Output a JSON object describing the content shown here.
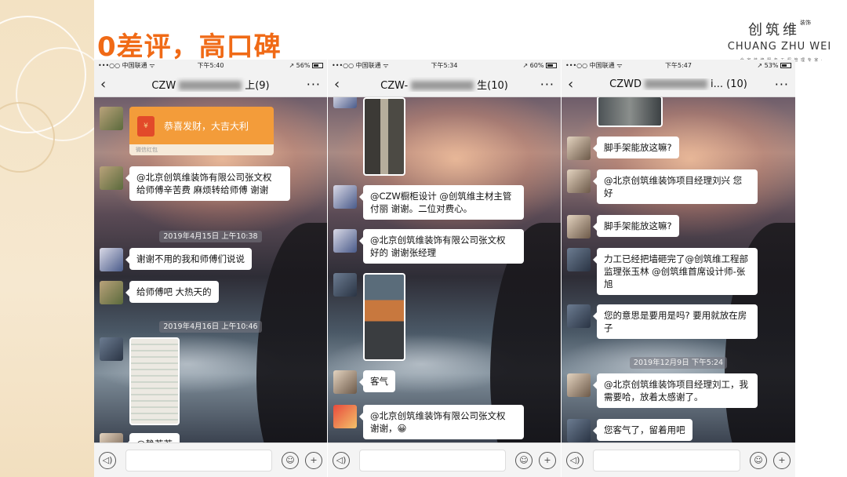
{
  "headline": "0差评，高口碑",
  "logo": {
    "cn": "创筑维",
    "cn_small": "装饰",
    "en": "CHUANG ZHU WEI",
    "slogan": "· 全 家 装 修 服 务 工 程 管 理 专 家 ·"
  },
  "icons": {
    "back": "‹",
    "more": "···",
    "voice": "◁)",
    "emoji": "☺",
    "plus": "+"
  },
  "phones": [
    {
      "status": {
        "carrier": "•••○○ 中国联通 ᯤ",
        "time": "下午5:40",
        "right": "↗ 56%"
      },
      "title_prefix": "CZW",
      "title_suffix": "上(9)",
      "redpacket": {
        "text": "恭喜发财，大吉大利",
        "foot": "微信红包"
      },
      "messages": [
        "@北京创筑维装饰有限公司张文权 给师傅辛苦费  麻烦转给师傅  谢谢",
        "谢谢不用的我和师傅们说说",
        "给师傅吧  大热天的",
        "@静若若"
      ],
      "stamps": [
        "2019年4月15日 上午10:38",
        "2019年4月16日 上午10:46"
      ]
    },
    {
      "status": {
        "carrier": "•••○○ 中国联通 ᯤ",
        "time": "下午5:34",
        "right": "↗ 60%"
      },
      "title_prefix": "CZW-",
      "title_suffix": "生(10)",
      "messages": [
        "@CZW橱柜设计 @创筑维主材主管付丽   谢谢。二位对费心。",
        "@北京创筑维装饰有限公司张文权  好的  谢谢张经理",
        "客气",
        "@北京创筑维装饰有限公司张文权  谢谢，😀"
      ]
    },
    {
      "status": {
        "carrier": "•••○○ 中国联通 ᯤ",
        "time": "下午5:47",
        "right": "↗ 53%"
      },
      "title_prefix": "CZWD",
      "title_suffix": "i... (10)",
      "messages": [
        "脚手架能放这嘛?",
        "@北京创筑维装饰项目经理刘兴 您好",
        "脚手架能放这嘛?",
        "力工已经把墙砸完了@创筑维工程部监理张玉林 @创筑维首席设计师-张旭",
        "您的意思是要用是吗? 要用就放在房子",
        "@北京创筑维装饰项目经理刘工，我需要哈，放着太感谢了。",
        "您客气了，留着用吧"
      ],
      "stamps": [
        "2019年12月9日 下午5:24"
      ]
    }
  ]
}
